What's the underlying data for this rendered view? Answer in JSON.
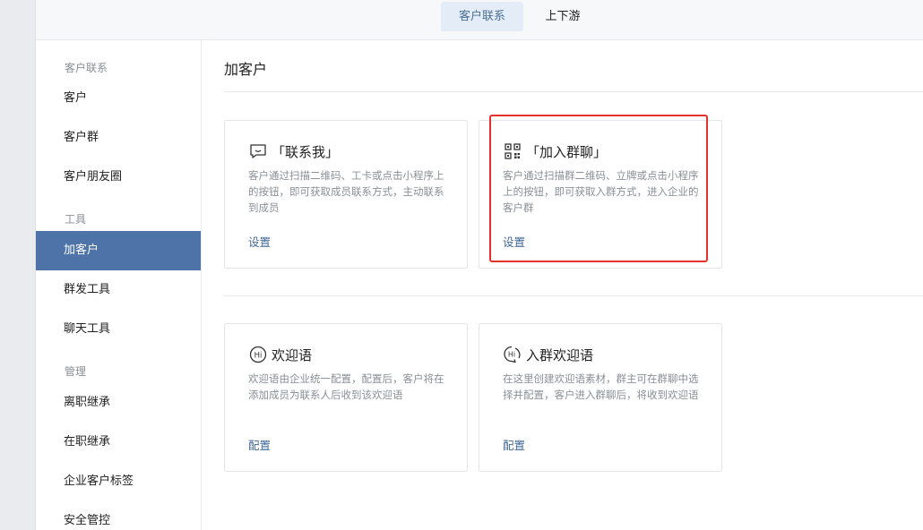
{
  "tabs": [
    {
      "label": "客户联系",
      "active": true
    },
    {
      "label": "上下游",
      "active": false
    }
  ],
  "sidebar": {
    "sections": {
      "contact": "客户联系",
      "tools": "工具",
      "manage": "管理"
    },
    "items": {
      "customer": "客户",
      "customer_group": "客户群",
      "moments": "客户朋友圈",
      "add_customer": "加客户",
      "broadcast": "群发工具",
      "chat_tools": "聊天工具",
      "resign_inherit": "离职继承",
      "onjob_inherit": "在职继承",
      "tags": "企业客户标签",
      "security": "安全管控"
    }
  },
  "main": {
    "title": "加客户",
    "cards": [
      {
        "icon": "chat-bubble-icon",
        "title": "「联系我」",
        "desc": "客户通过扫描二维码、工卡或点击小程序上的按钮，即可获取成员联系方式，主动联系到成员",
        "link": "设置"
      },
      {
        "icon": "qr-code-icon",
        "title": "「加入群聊」",
        "desc": "客户通过扫描群二维码、立牌或点击小程序上的按钮，即可获取入群方式，进入企业的客户群",
        "link": "设置"
      },
      {
        "icon": "hi-circle-icon",
        "title": "欢迎语",
        "desc": "欢迎语由企业统一配置，配置后，客户将在添加成员为联系人后收到该欢迎语",
        "link": "配置"
      },
      {
        "icon": "hi-bubble-icon",
        "title": "入群欢迎语",
        "desc": "在这里创建欢迎语素材，群主可在群聊中选择并配置，客户进入群聊后，将收到欢迎语",
        "link": "配置"
      }
    ]
  },
  "colors": {
    "accent": "#4e73a8",
    "link": "#3f6796",
    "highlight": "#e5312c"
  }
}
